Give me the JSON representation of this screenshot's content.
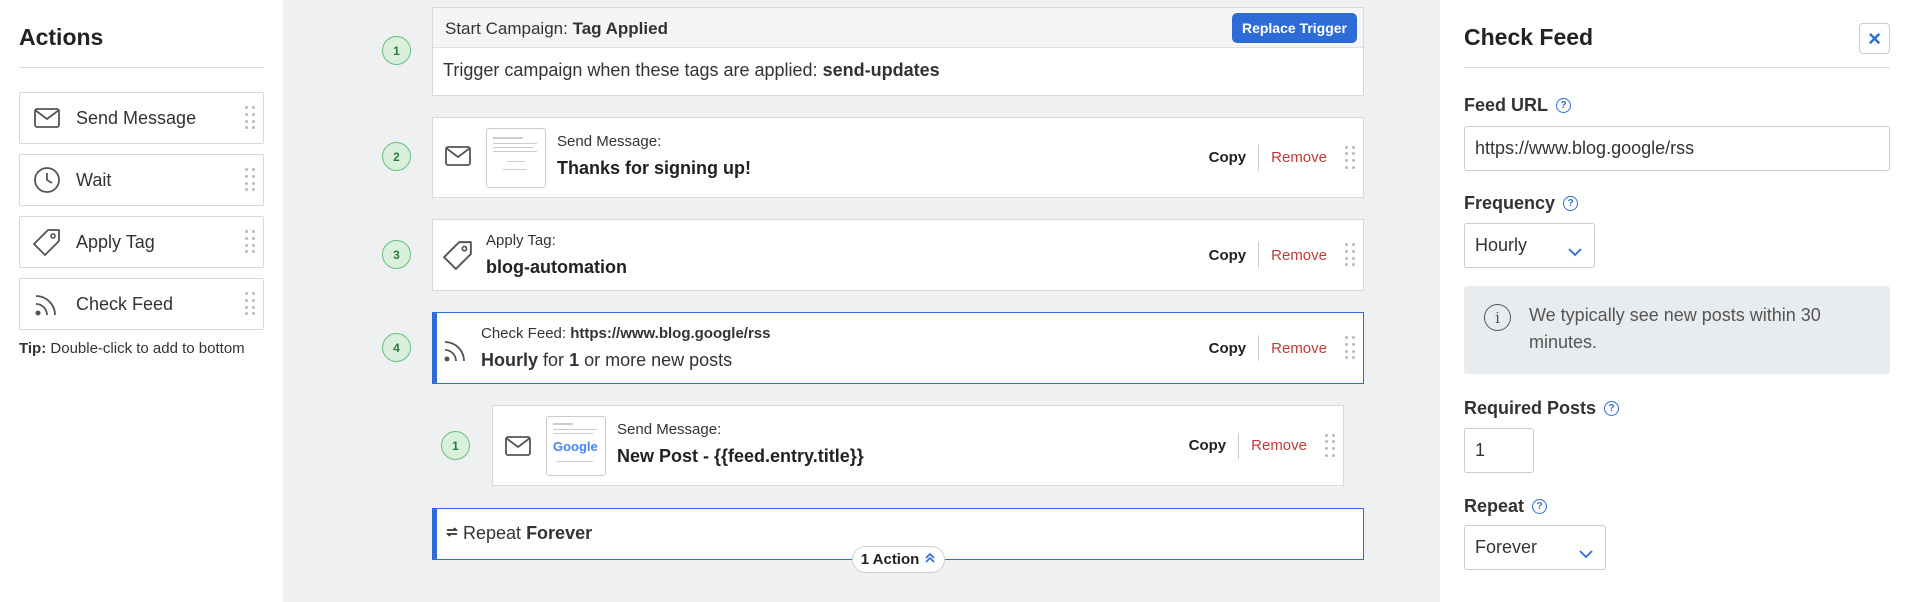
{
  "actions_panel": {
    "title": "Actions",
    "items": [
      {
        "label": "Send Message",
        "icon": "envelope-icon"
      },
      {
        "label": "Wait",
        "icon": "clock-icon"
      },
      {
        "label": "Apply Tag",
        "icon": "tag-icon"
      },
      {
        "label": "Check Feed",
        "icon": "rss-icon"
      }
    ],
    "tip_label": "Tip:",
    "tip_text": "Double-click to add to bottom"
  },
  "workflow": {
    "trigger": {
      "step": "1",
      "head_prefix": "Start Campaign:",
      "head_value": "Tag Applied",
      "replace_label": "Replace Trigger",
      "body_prefix": "Trigger campaign when these tags are applied:",
      "body_value": "send-updates"
    },
    "steps": [
      {
        "step": "2",
        "type_label": "Send Message:",
        "value": "Thanks for signing up!",
        "copy": "Copy",
        "remove": "Remove"
      },
      {
        "step": "3",
        "type_label": "Apply Tag:",
        "value": "blog-automation",
        "copy": "Copy",
        "remove": "Remove"
      },
      {
        "step": "4",
        "type_label": "Check Feed:",
        "url": "https://www.blog.google/rss",
        "freq": "Hourly",
        "for_word": "for",
        "count": "1",
        "suffix": "or more new posts",
        "copy": "Copy",
        "remove": "Remove"
      }
    ],
    "nested": {
      "step": "1",
      "type_label": "Send Message:",
      "value": "New Post - {{feed.entry.title}}",
      "copy": "Copy",
      "remove": "Remove",
      "thumb_logo": "Google"
    },
    "repeat": {
      "prefix": "Repeat",
      "value": "Forever"
    },
    "action_pill": "1 Action"
  },
  "settings_panel": {
    "title": "Check Feed",
    "feed_url_label": "Feed URL",
    "feed_url_value": "https://www.blog.google/rss",
    "frequency_label": "Frequency",
    "frequency_value": "Hourly",
    "info_text": "We typically see new posts within 30 minutes.",
    "required_posts_label": "Required Posts",
    "required_posts_value": "1",
    "repeat_label": "Repeat",
    "repeat_value": "Forever",
    "help_glyph": "?",
    "close_glyph": "×",
    "info_glyph": "i"
  },
  "colors": {
    "accent": "#2e6bd6",
    "remove": "#c23a3a",
    "step_green": "#d8f0dc",
    "canvas": "#eef0f2"
  }
}
